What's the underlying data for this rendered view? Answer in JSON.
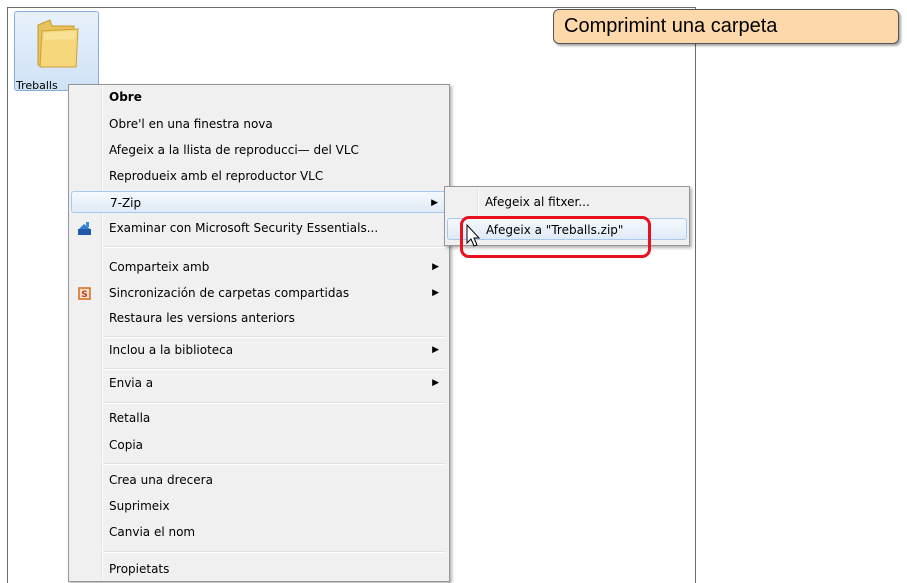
{
  "folder": {
    "label": "Treballs",
    "icon": "folder-icon"
  },
  "banner": {
    "title": "Comprimint una carpeta"
  },
  "context_menu": {
    "items": {
      "obre": "Obre",
      "obre_nova": "Obre'l en una finestra nova",
      "afegeix_vlc": "Afegeix a la llista de reproducci— del VLC",
      "reprodueix_vlc": "Reprodueix amb el reproductor VLC",
      "seven_zip": "7-Zip",
      "examinar_mse": "Examinar con Microsoft Security Essentials...",
      "comparteix": "Comparteix amb",
      "sincronizacion": "Sincronización de carpetas compartidas",
      "restaura": "Restaura les versions anteriors",
      "inclou": "Inclou a la biblioteca",
      "envia": "Envia a",
      "retalla": "Retalla",
      "copia": "Copia",
      "crea_drecera": "Crea una drecera",
      "suprimeix": "Suprimeix",
      "canvia_nom": "Canvia el nom",
      "propietats": "Propietats"
    },
    "submenu_arrow": "▶"
  },
  "submenu_7zip": {
    "items": {
      "afegeix_fitxer": "Afegeix al fitxer...",
      "afegeix_zip": "Afegeix a \"Treballs.zip\""
    }
  },
  "colors": {
    "highlight_ring": "#e8101d",
    "banner_bg": "#fdd8aa"
  }
}
